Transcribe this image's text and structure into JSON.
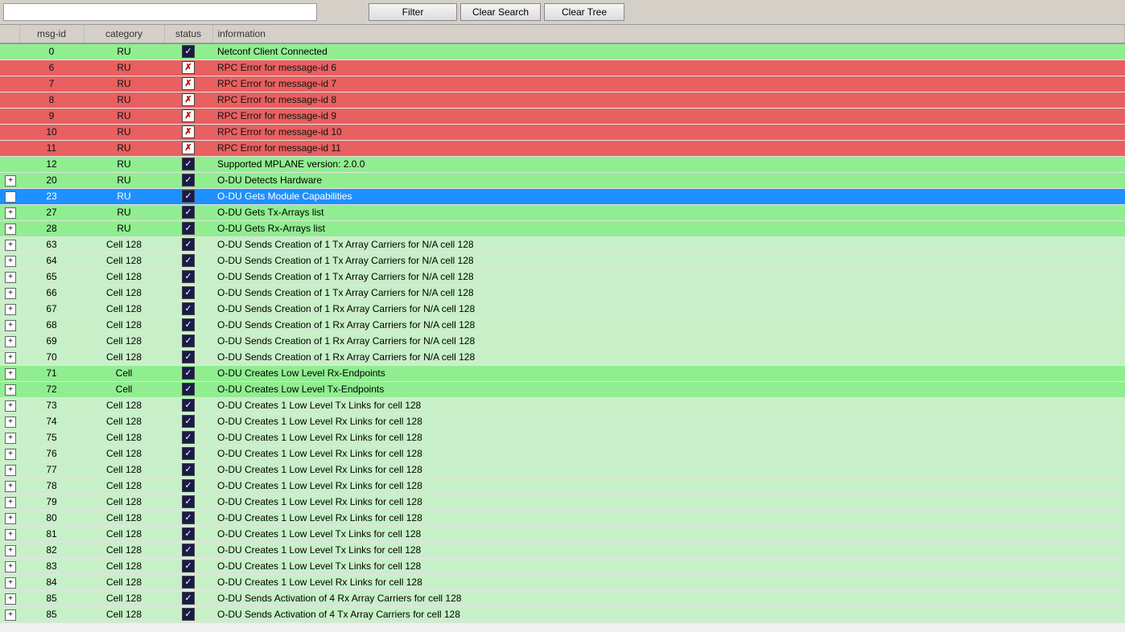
{
  "toolbar": {
    "search_placeholder": "",
    "filter_label": "Filter",
    "clear_search_label": "Clear Search",
    "clear_tree_label": "Clear Tree"
  },
  "table": {
    "columns": [
      "msg-id",
      "category",
      "status",
      "information"
    ],
    "rows": [
      {
        "id": 0,
        "category": "RU",
        "status": "check",
        "information": "Netconf Client Connected",
        "style": "green",
        "expand": false,
        "selected": false
      },
      {
        "id": 6,
        "category": "RU",
        "status": "error",
        "information": "RPC Error for message-id 6",
        "style": "red",
        "expand": false,
        "selected": false
      },
      {
        "id": 7,
        "category": "RU",
        "status": "error",
        "information": "RPC Error for message-id 7",
        "style": "red",
        "expand": false,
        "selected": false
      },
      {
        "id": 8,
        "category": "RU",
        "status": "error",
        "information": "RPC Error for message-id 8",
        "style": "red",
        "expand": false,
        "selected": false
      },
      {
        "id": 9,
        "category": "RU",
        "status": "error",
        "information": "RPC Error for message-id 9",
        "style": "red",
        "expand": false,
        "selected": false
      },
      {
        "id": 10,
        "category": "RU",
        "status": "error",
        "information": "RPC Error for message-id 10",
        "style": "red",
        "expand": false,
        "selected": false
      },
      {
        "id": 11,
        "category": "RU",
        "status": "error",
        "information": "RPC Error for message-id 11",
        "style": "red",
        "expand": false,
        "selected": false
      },
      {
        "id": 12,
        "category": "RU",
        "status": "check",
        "information": "Supported MPLANE version: 2.0.0",
        "style": "green",
        "expand": false,
        "selected": false
      },
      {
        "id": 20,
        "category": "RU",
        "status": "check",
        "information": "O-DU Detects Hardware",
        "style": "green",
        "expand": true,
        "selected": false
      },
      {
        "id": 23,
        "category": "RU",
        "status": "check",
        "information": "O-DU Gets Module Capabilities",
        "style": "blue",
        "expand": true,
        "selected": true
      },
      {
        "id": 27,
        "category": "RU",
        "status": "check",
        "information": "O-DU Gets Tx-Arrays list",
        "style": "green",
        "expand": true,
        "selected": false
      },
      {
        "id": 28,
        "category": "RU",
        "status": "check",
        "information": "O-DU Gets Rx-Arrays list",
        "style": "green",
        "expand": true,
        "selected": false
      },
      {
        "id": 63,
        "category": "Cell 128",
        "status": "check",
        "information": "O-DU Sends Creation of 1 Tx Array Carriers for N/A cell 128",
        "style": "light-green",
        "expand": true,
        "selected": false
      },
      {
        "id": 64,
        "category": "Cell 128",
        "status": "check",
        "information": "O-DU Sends Creation of 1 Tx Array Carriers for N/A cell 128",
        "style": "light-green",
        "expand": true,
        "selected": false
      },
      {
        "id": 65,
        "category": "Cell 128",
        "status": "check",
        "information": "O-DU Sends Creation of 1 Tx Array Carriers for N/A cell 128",
        "style": "light-green",
        "expand": true,
        "selected": false
      },
      {
        "id": 66,
        "category": "Cell 128",
        "status": "check",
        "information": "O-DU Sends Creation of 1 Tx Array Carriers for N/A cell 128",
        "style": "light-green",
        "expand": true,
        "selected": false
      },
      {
        "id": 67,
        "category": "Cell 128",
        "status": "check",
        "information": "O-DU Sends Creation of 1 Rx Array Carriers for N/A cell 128",
        "style": "light-green",
        "expand": true,
        "selected": false
      },
      {
        "id": 68,
        "category": "Cell 128",
        "status": "check",
        "information": "O-DU Sends Creation of 1 Rx Array Carriers for N/A cell 128",
        "style": "light-green",
        "expand": true,
        "selected": false
      },
      {
        "id": 69,
        "category": "Cell 128",
        "status": "check",
        "information": "O-DU Sends Creation of 1 Rx Array Carriers for N/A cell 128",
        "style": "light-green",
        "expand": true,
        "selected": false
      },
      {
        "id": 70,
        "category": "Cell 128",
        "status": "check",
        "information": "O-DU Sends Creation of 1 Rx Array Carriers for N/A cell 128",
        "style": "light-green",
        "expand": true,
        "selected": false
      },
      {
        "id": 71,
        "category": "Cell",
        "status": "check",
        "information": "O-DU Creates Low Level Rx-Endpoints",
        "style": "green",
        "expand": true,
        "selected": false
      },
      {
        "id": 72,
        "category": "Cell",
        "status": "check",
        "information": "O-DU Creates Low Level Tx-Endpoints",
        "style": "green",
        "expand": true,
        "selected": false
      },
      {
        "id": 73,
        "category": "Cell 128",
        "status": "check",
        "information": "O-DU Creates 1 Low Level Tx Links for cell 128",
        "style": "light-green",
        "expand": true,
        "selected": false
      },
      {
        "id": 74,
        "category": "Cell 128",
        "status": "check",
        "information": "O-DU Creates 1 Low Level Rx Links for cell 128",
        "style": "light-green",
        "expand": true,
        "selected": false
      },
      {
        "id": 75,
        "category": "Cell 128",
        "status": "check",
        "information": "O-DU Creates 1 Low Level Rx Links for cell 128",
        "style": "light-green",
        "expand": true,
        "selected": false
      },
      {
        "id": 76,
        "category": "Cell 128",
        "status": "check",
        "information": "O-DU Creates 1 Low Level Rx Links for cell 128",
        "style": "light-green",
        "expand": true,
        "selected": false
      },
      {
        "id": 77,
        "category": "Cell 128",
        "status": "check",
        "information": "O-DU Creates 1 Low Level Rx Links for cell 128",
        "style": "light-green",
        "expand": true,
        "selected": false
      },
      {
        "id": 78,
        "category": "Cell 128",
        "status": "check",
        "information": "O-DU Creates 1 Low Level Rx Links for cell 128",
        "style": "light-green",
        "expand": true,
        "selected": false
      },
      {
        "id": 79,
        "category": "Cell 128",
        "status": "check",
        "information": "O-DU Creates 1 Low Level Rx Links for cell 128",
        "style": "light-green",
        "expand": true,
        "selected": false
      },
      {
        "id": 80,
        "category": "Cell 128",
        "status": "check",
        "information": "O-DU Creates 1 Low Level Rx Links for cell 128",
        "style": "light-green",
        "expand": true,
        "selected": false
      },
      {
        "id": 81,
        "category": "Cell 128",
        "status": "check",
        "information": "O-DU Creates 1 Low Level Tx Links for cell 128",
        "style": "light-green",
        "expand": true,
        "selected": false
      },
      {
        "id": 82,
        "category": "Cell 128",
        "status": "check",
        "information": "O-DU Creates 1 Low Level Tx Links for cell 128",
        "style": "light-green",
        "expand": true,
        "selected": false
      },
      {
        "id": 83,
        "category": "Cell 128",
        "status": "check",
        "information": "O-DU Creates 1 Low Level Tx Links for cell 128",
        "style": "light-green",
        "expand": true,
        "selected": false
      },
      {
        "id": 84,
        "category": "Cell 128",
        "status": "check",
        "information": "O-DU Creates 1 Low Level Rx Links for cell 128",
        "style": "light-green",
        "expand": true,
        "selected": false
      },
      {
        "id": 85,
        "category": "Cell 128",
        "status": "check",
        "information": "O-DU Sends Activation of 4 Rx Array Carriers for cell 128",
        "style": "light-green",
        "expand": true,
        "selected": false
      },
      {
        "id": 85,
        "category": "Cell 128",
        "status": "check",
        "information": "O-DU Sends Activation of 4 Tx Array Carriers for cell 128",
        "style": "light-green",
        "expand": true,
        "selected": false
      }
    ]
  }
}
